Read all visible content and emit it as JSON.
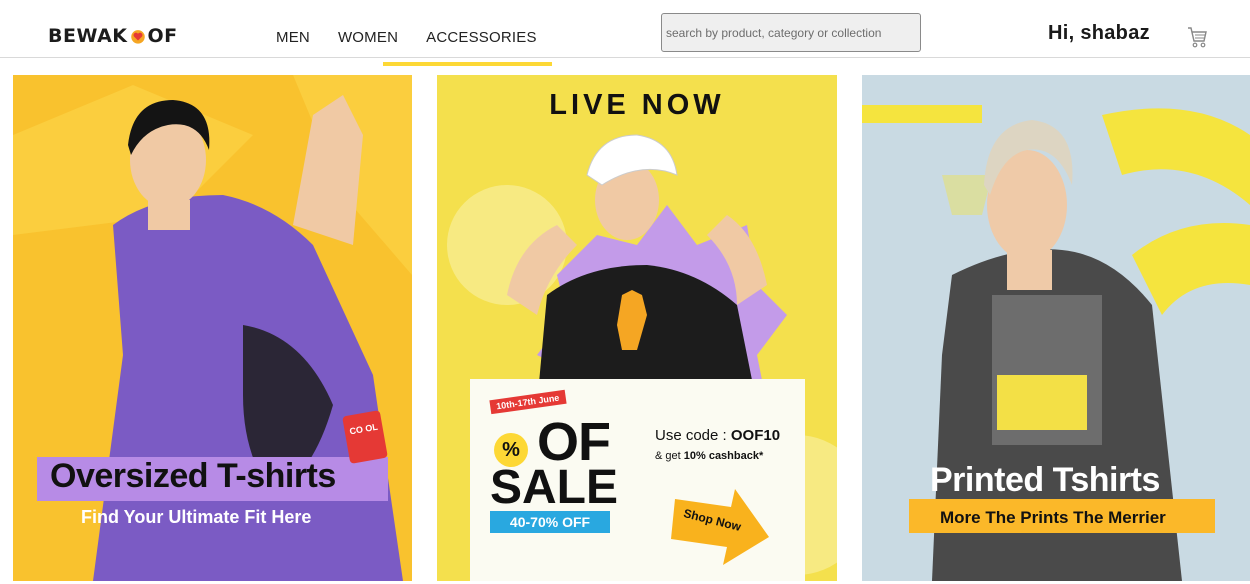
{
  "header": {
    "logo_text_a": "BEWAK",
    "logo_text_b": "OF",
    "nav": [
      "MEN",
      "WOMEN",
      "ACCESSORIES"
    ],
    "search_placeholder": "search by product, category or collection",
    "greeting": "Hi, shabaz",
    "cart_icon": "cart-icon"
  },
  "banners": [
    {
      "title": "Oversized T-shirts",
      "subtitle": "Find Your Ultimate Fit Here",
      "tag": "CO OL"
    },
    {
      "headline": "LIVE NOW",
      "date_tag": "10th-17th June",
      "sale_word_1": "OF",
      "sale_pct": "%",
      "sale_word_2": "SALE",
      "discount": "40-70% OFF",
      "code_label": "Use code : ",
      "code": "OOF10",
      "cashback_a": "& get ",
      "cashback_b": "10% cashback*",
      "cta": "Shop Now"
    },
    {
      "title": "Printed Tshirts",
      "subtitle": "More The Prints The Merrier"
    }
  ],
  "colors": {
    "accent_yellow": "#fdd835",
    "banner1_bg": "#f9c22e",
    "banner1_label_bg": "#b78be6",
    "banner2_bg": "#f4e04d",
    "banner2_blue": "#29a8e0",
    "banner3_bg": "#c9dae3",
    "banner3_label_bg": "#fbb829"
  }
}
